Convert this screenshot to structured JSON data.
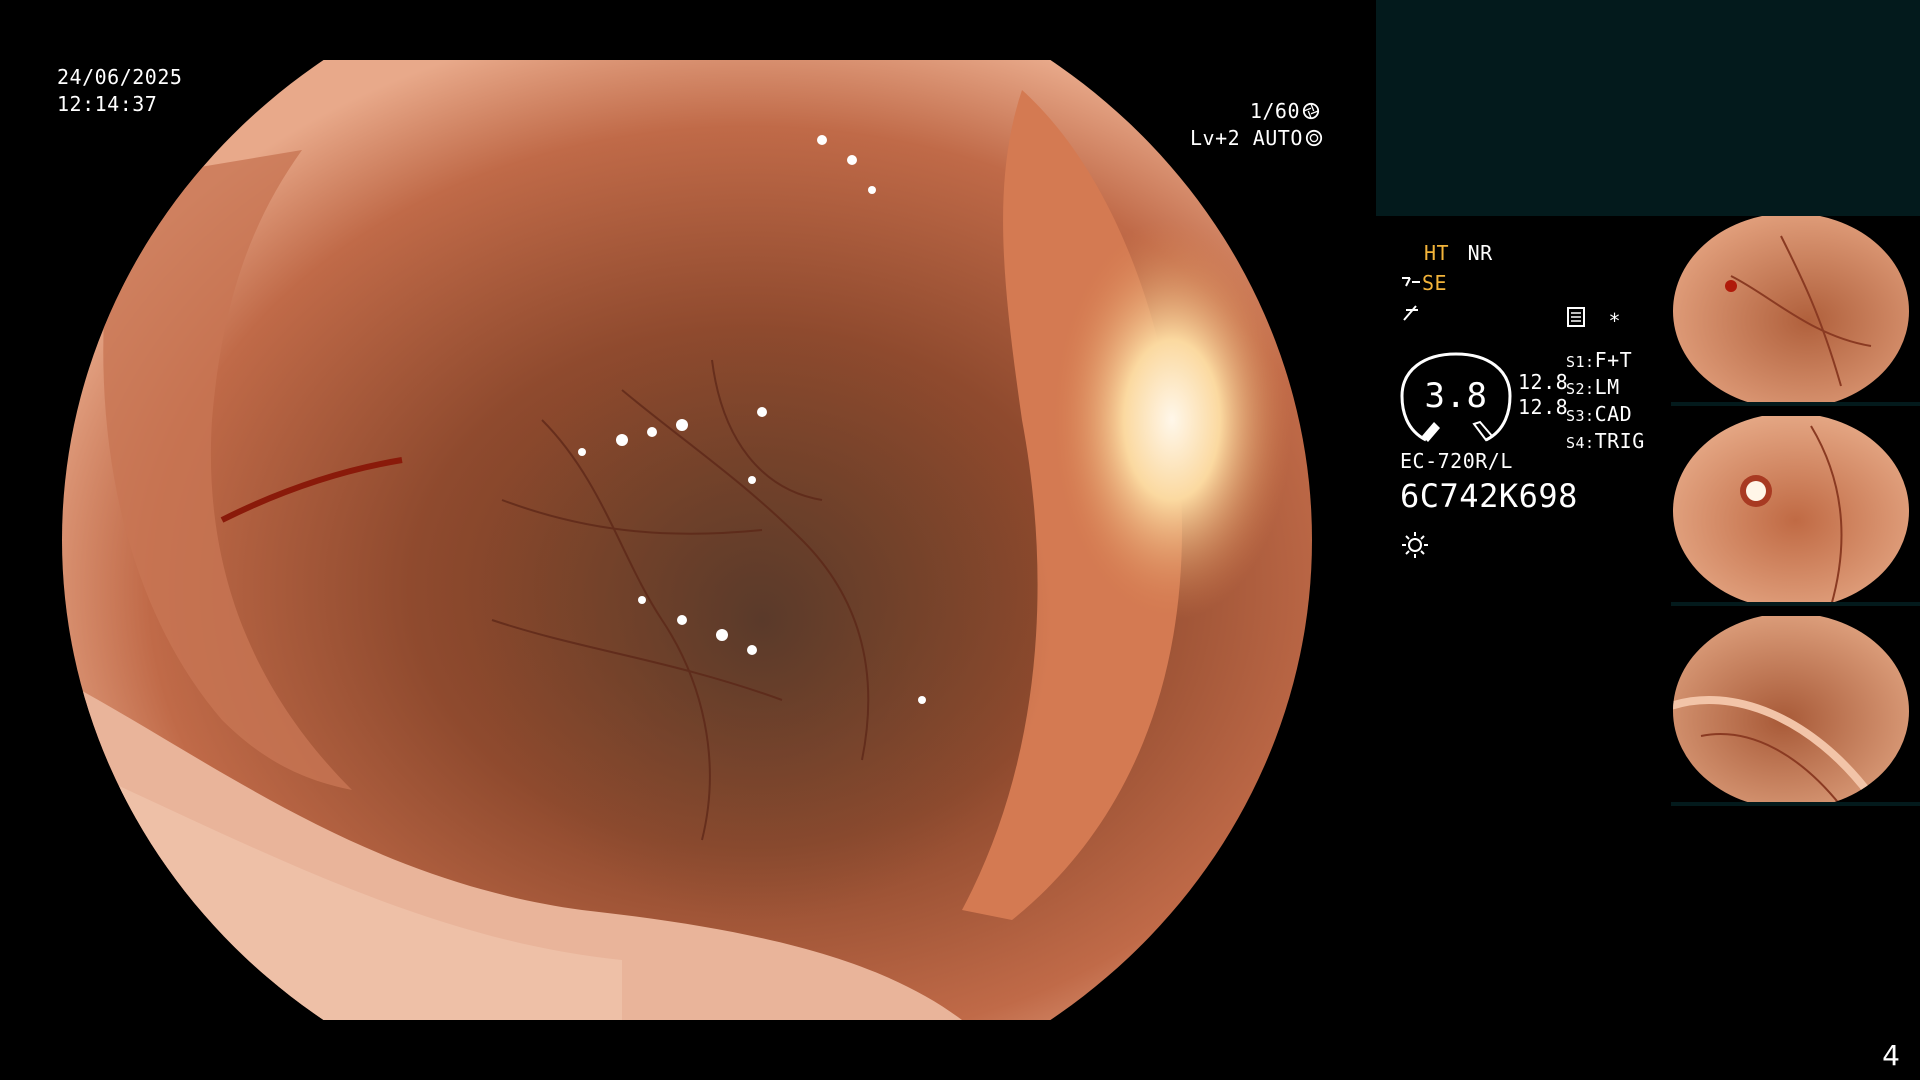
{
  "overlay": {
    "date": "24/06/2025",
    "time": "12:14:37",
    "shutter": "1/60",
    "level_mode": "Lv+2 AUTO"
  },
  "status": {
    "ht": "HT",
    "nr": "NR",
    "se": "SE",
    "enhancement_value": "3.8",
    "left_readouts": [
      "12.8",
      "12.8"
    ],
    "presets": [
      {
        "key": "S1:",
        "value": "F+T"
      },
      {
        "key": "S2:",
        "value": "LM"
      },
      {
        "key": "S3:",
        "value": "CAD"
      },
      {
        "key": "S4:",
        "value": "TRIG"
      }
    ],
    "scope_model": "EC-720R/L",
    "serial": "6C742K698",
    "star": "*"
  },
  "page_number": "4",
  "icons": {
    "shutter_icon": "aperture-icon",
    "auto_icon": "iris-icon",
    "brightness_icon": "sun-icon",
    "memo_icon": "memo-icon"
  },
  "colors": {
    "background": "#000000",
    "panel": "#031a1c",
    "accent_yellow": "#f3b43a",
    "tissue": "#a8553a"
  }
}
